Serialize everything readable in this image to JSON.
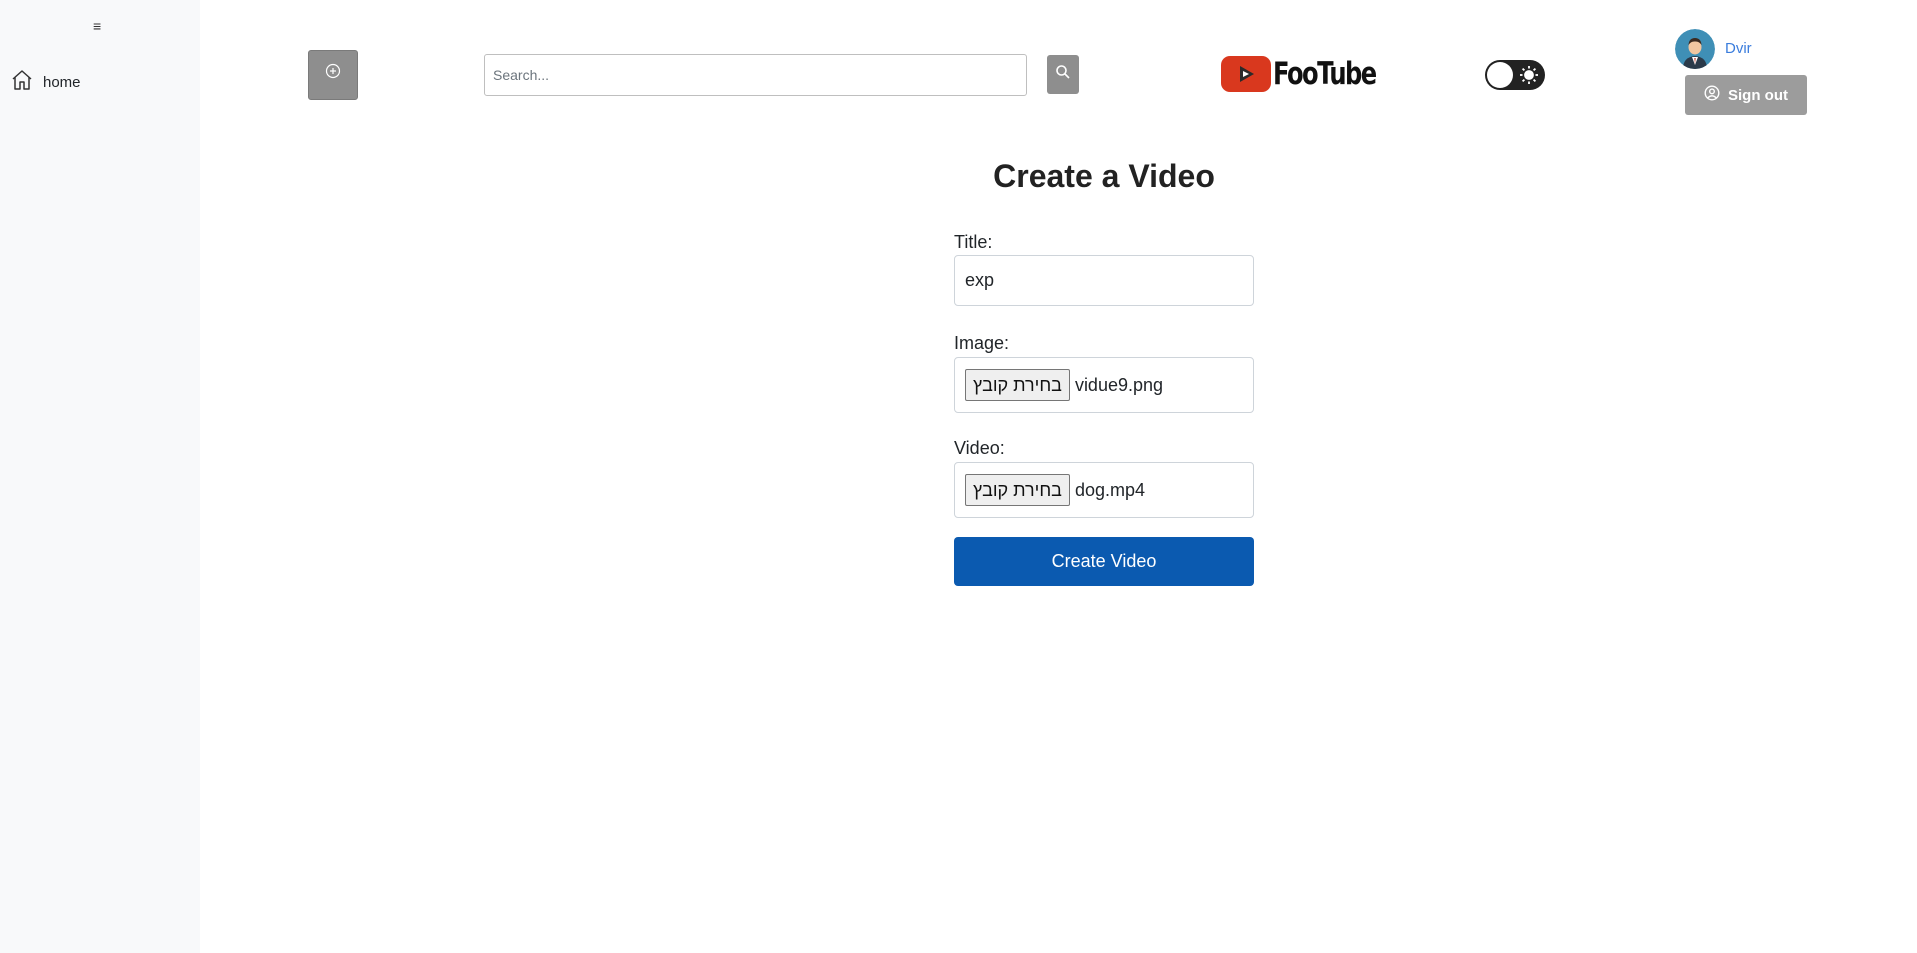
{
  "sidebar": {
    "menu_toggle": "≡",
    "items": [
      {
        "label": "home",
        "icon": "home-icon"
      }
    ]
  },
  "header": {
    "upload_icon": "plus-circle-icon",
    "search": {
      "placeholder": "Search...",
      "value": ""
    },
    "search_icon": "search-icon",
    "logo": {
      "text": "FooTube",
      "brand_color": "#d9381e"
    },
    "theme_toggle": {
      "state": "light",
      "icon": "sun-icon"
    },
    "user": {
      "name": "Dvir",
      "avatar_icon": "user-avatar"
    },
    "signout_label": "Sign out"
  },
  "form": {
    "heading": "Create a Video",
    "title_label": "Title:",
    "title_value": "exp",
    "image_label": "Image:",
    "image_button": "בחירת קובץ",
    "image_file": "vidue9.png",
    "video_label": "Video:",
    "video_button": "בחירת קובץ",
    "video_file": "dog.mp4",
    "submit_label": "Create Video",
    "submit_color": "#0b5ab0"
  }
}
